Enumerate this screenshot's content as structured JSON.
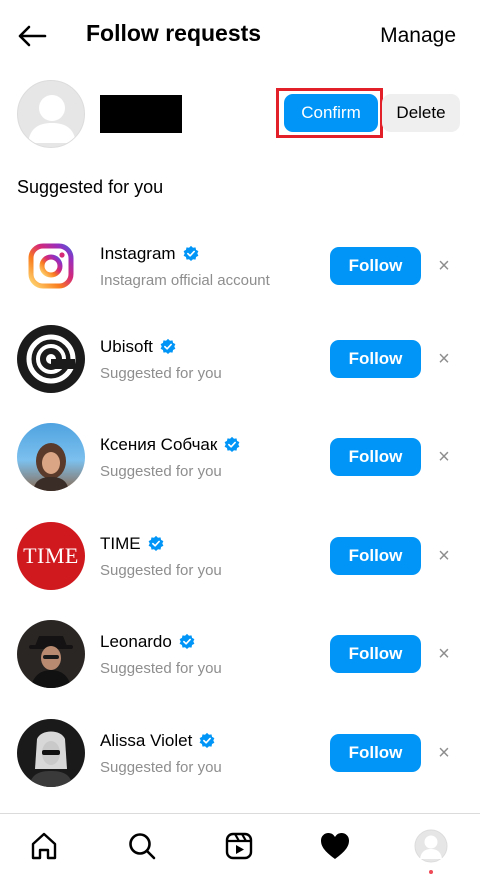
{
  "header": {
    "back_icon": "arrow-left-icon",
    "title": "Follow requests",
    "manage_label": "Manage"
  },
  "request": {
    "avatar_icon": "default-avatar-icon",
    "confirm_label": "Confirm",
    "delete_label": "Delete",
    "accent_color": "#0095f6",
    "highlight_color": "#e2202a"
  },
  "suggested": {
    "title": "Suggested for you",
    "follow_label": "Follow",
    "dismiss_symbol": "×",
    "items": [
      {
        "name": "Instagram",
        "subtitle": "Instagram official account",
        "verified": true
      },
      {
        "name": "Ubisoft",
        "subtitle": "Suggested for you",
        "verified": true
      },
      {
        "name": "Ксения Собчак",
        "subtitle": "Suggested for you",
        "verified": true
      },
      {
        "name": "TIME",
        "subtitle": "Suggested for you",
        "verified": true,
        "logo_text": "TIME"
      },
      {
        "name": "Leonardo",
        "subtitle": "Suggested for you",
        "verified": true
      },
      {
        "name": "Alissa Violet",
        "subtitle": "Suggested for you",
        "verified": true
      }
    ]
  },
  "bottom_nav": {
    "items": [
      "home-icon",
      "search-icon",
      "reels-icon",
      "heart-icon",
      "profile-avatar-icon"
    ]
  }
}
